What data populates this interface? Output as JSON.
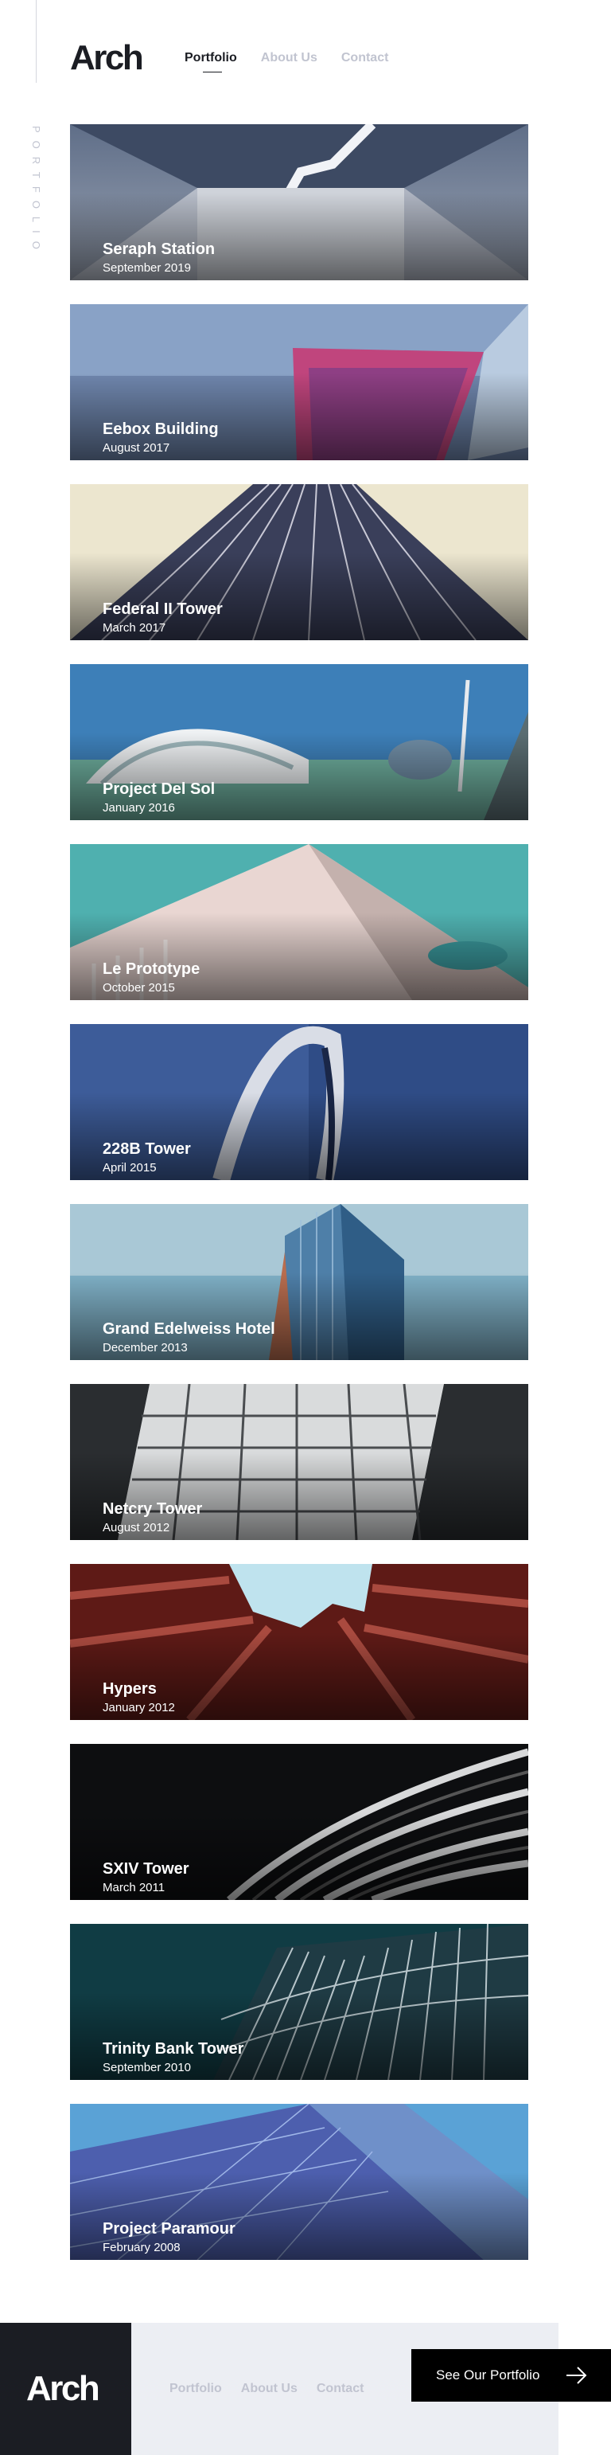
{
  "header": {
    "logo": "Arch",
    "nav": [
      {
        "label": "Portfolio",
        "active": true
      },
      {
        "label": "About Us",
        "active": false
      },
      {
        "label": "Contact",
        "active": false
      }
    ],
    "side_label": "Portfolio"
  },
  "projects": [
    {
      "title": "Seraph Station",
      "date": "September 2019"
    },
    {
      "title": "Eebox Building",
      "date": "August 2017"
    },
    {
      "title": "Federal II Tower",
      "date": "March 2017"
    },
    {
      "title": "Project Del Sol",
      "date": "January 2016"
    },
    {
      "title": "Le Prototype",
      "date": "October 2015"
    },
    {
      "title": "228B Tower",
      "date": "April 2015"
    },
    {
      "title": "Grand Edelweiss Hotel",
      "date": "December 2013"
    },
    {
      "title": "Netcry Tower",
      "date": "August 2012"
    },
    {
      "title": "Hypers",
      "date": "January 2012"
    },
    {
      "title": "SXIV Tower",
      "date": "March 2011"
    },
    {
      "title": "Trinity Bank Tower",
      "date": "September 2010"
    },
    {
      "title": "Project Paramour",
      "date": "February 2008"
    }
  ],
  "footer": {
    "logo": "Arch",
    "nav": [
      "Portfolio",
      "About Us",
      "Contact"
    ],
    "cta_label": "See Our Portfolio",
    "cta_icon": "arrow-right-icon"
  },
  "colors": {
    "dark": "#1b1d23",
    "muted": "#c1c4d0",
    "footer_bg": "#eceef3"
  }
}
